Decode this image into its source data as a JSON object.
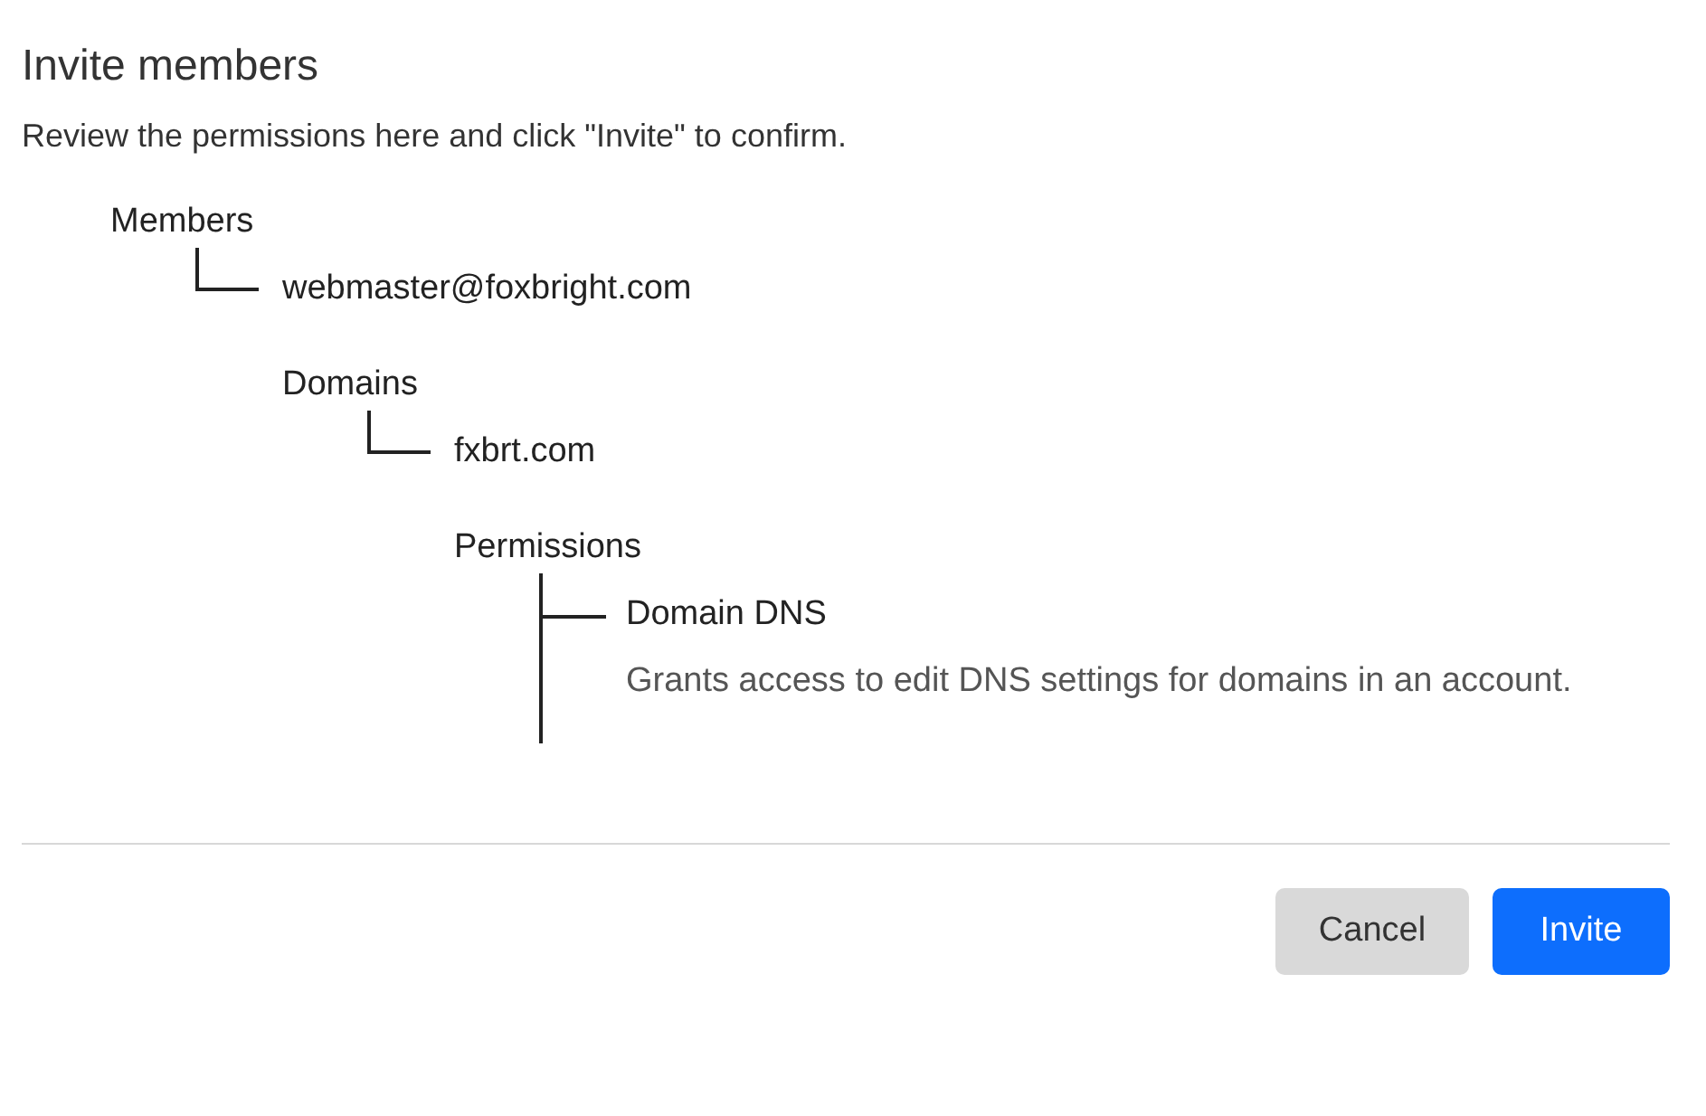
{
  "dialog": {
    "title": "Invite members",
    "subtitle": "Review the permissions here and click \"Invite\" to confirm.",
    "tree": [
      {
        "label": "Members",
        "children": [
          {
            "label": "webmaster@foxbright.com",
            "children": [
              {
                "label": "Domains",
                "children": [
                  {
                    "label": "fxbrt.com",
                    "children": [
                      {
                        "label": "Permissions",
                        "children": [
                          {
                            "label": "Domain DNS",
                            "description": "Grants access to edit DNS settings for domains in an account."
                          }
                        ]
                      }
                    ]
                  }
                ]
              }
            ]
          }
        ]
      }
    ],
    "buttons": [
      {
        "label": "Cancel",
        "kind": "secondary"
      },
      {
        "label": "Invite",
        "kind": "primary"
      }
    ]
  }
}
